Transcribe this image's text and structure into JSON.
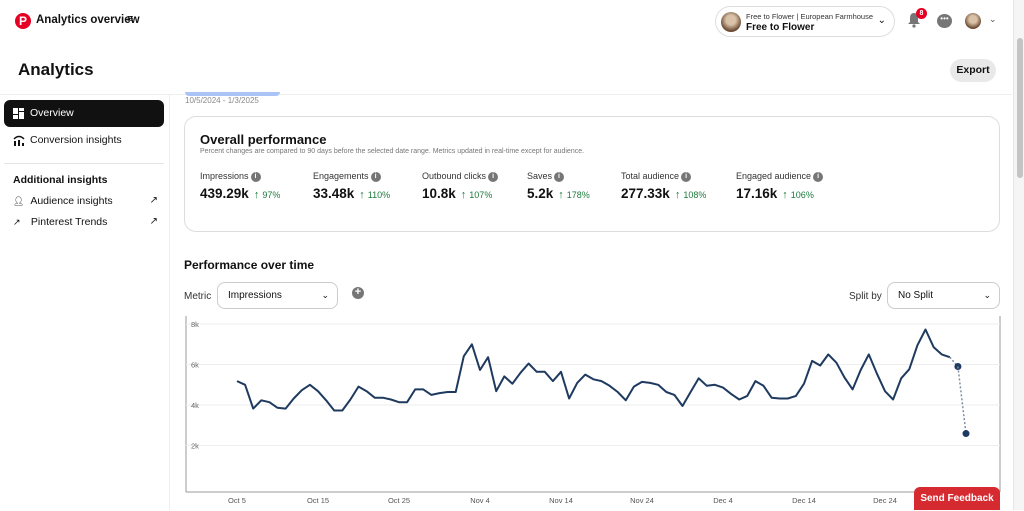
{
  "topbar": {
    "app_title": "Analytics overview",
    "logo_letter": "P",
    "menu_icon": "≡",
    "account": {
      "subtitle": "Free to Flower | European Farmhouse",
      "name": "Free to Flower"
    },
    "notifications_count": "8"
  },
  "page": {
    "title": "Analytics",
    "export_label": "Export",
    "date_range": "10/5/2024 - 1/3/2025"
  },
  "sidebar": {
    "items": [
      {
        "label": "Overview",
        "icon": "dashboard-icon",
        "active": true
      },
      {
        "label": "Conversion insights",
        "icon": "conversion-icon",
        "active": false
      }
    ],
    "additional_heading": "Additional insights",
    "links": [
      {
        "label": "Audience insights",
        "icon": "person-icon"
      },
      {
        "label": "Pinterest Trends",
        "icon": "trend-icon"
      }
    ]
  },
  "overall": {
    "title": "Overall performance",
    "subtitle": "Percent changes are compared to 90 days before the selected date range. Metrics updated in real-time except for audience.",
    "metrics": [
      {
        "label": "Impressions",
        "value": "439.29k",
        "change": "97%"
      },
      {
        "label": "Engagements",
        "value": "33.48k",
        "change": "110%"
      },
      {
        "label": "Outbound clicks",
        "value": "10.8k",
        "change": "107%"
      },
      {
        "label": "Saves",
        "value": "5.2k",
        "change": "178%"
      },
      {
        "label": "Total audience",
        "value": "277.33k",
        "change": "108%"
      },
      {
        "label": "Engaged audience",
        "value": "17.16k",
        "change": "106%"
      }
    ]
  },
  "performance": {
    "title": "Performance over time",
    "metric_label": "Metric",
    "metric_value": "Impressions",
    "split_label": "Split by",
    "split_value": "No Split"
  },
  "feedback_label": "Send Feedback",
  "colors": {
    "brand": "#e60023",
    "line": "#1f3a5f",
    "positive": "#1d7a3d",
    "feedback": "#d52a2f"
  },
  "chart_data": {
    "type": "line",
    "title": "Performance over time",
    "xlabel": "",
    "ylabel": "Impressions",
    "ylim": [
      0,
      8000
    ],
    "yticks": [
      "2k",
      "4k",
      "6k",
      "8k"
    ],
    "ytick_values": [
      2000,
      4000,
      6000,
      8000
    ],
    "xticks": [
      "Oct 5",
      "Oct 15",
      "Oct 25",
      "Nov 4",
      "Nov 14",
      "Nov 24",
      "Dec 4",
      "Dec 14",
      "Dec 24"
    ],
    "xtick_day_index": [
      0,
      10,
      20,
      30,
      40,
      50,
      60,
      70,
      80
    ],
    "grid": true,
    "series": [
      {
        "name": "Impressions",
        "start_date": "Oct 5",
        "values": [
          5180,
          5000,
          3820,
          4230,
          4140,
          3860,
          3820,
          4320,
          4730,
          5000,
          4680,
          4230,
          3730,
          3730,
          4270,
          4910,
          4680,
          4360,
          4360,
          4270,
          4140,
          4140,
          4770,
          4770,
          4500,
          4590,
          4640,
          4640,
          6410,
          7000,
          5730,
          6360,
          4680,
          5410,
          5050,
          5590,
          6050,
          5640,
          5640,
          5180,
          5640,
          4320,
          5090,
          5500,
          5270,
          5180,
          4950,
          4640,
          4230,
          4910,
          5140,
          5090,
          5000,
          4640,
          4500,
          3950,
          4640,
          5320,
          4950,
          5000,
          4860,
          4550,
          4270,
          4450,
          5180,
          4950,
          4360,
          4320,
          4320,
          4450,
          5050,
          6180,
          5950,
          6500,
          6090,
          5360,
          4770,
          5730,
          6500,
          5550,
          4680,
          4270,
          5320,
          5770,
          6950,
          7730,
          6860,
          6500,
          6360
        ],
        "preliminary_values": [
          5900,
          2590
        ]
      }
    ]
  }
}
